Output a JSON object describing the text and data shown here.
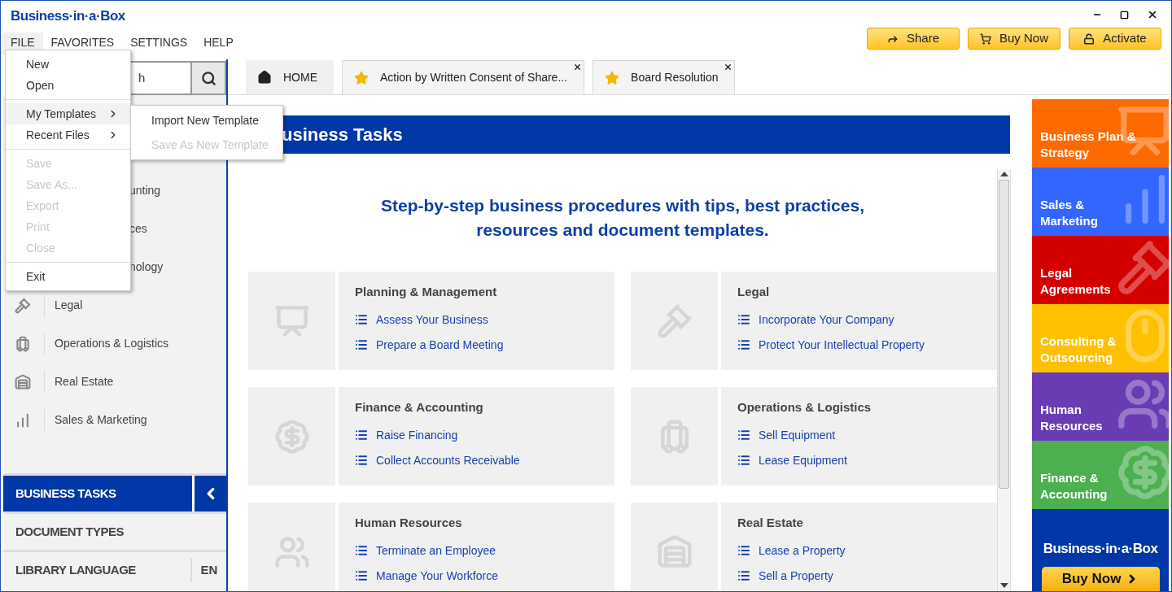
{
  "app": {
    "logo": "Business·in·a·Box"
  },
  "menu_bar": [
    {
      "label": "FILE",
      "selected": true
    },
    {
      "label": "FAVORITES",
      "selected": false
    },
    {
      "label": "SETTINGS",
      "selected": false
    },
    {
      "label": "HELP",
      "selected": false
    }
  ],
  "header_buttons": [
    {
      "label": "Share",
      "kind": "share"
    },
    {
      "label": "Buy Now",
      "kind": "cart"
    },
    {
      "label": "Activate",
      "kind": "lock"
    }
  ],
  "search": {
    "placeholder": "h"
  },
  "tabs": [
    {
      "label": "HOME",
      "kind": "home",
      "selected": true,
      "closable": false
    },
    {
      "label": "Action by Written Consent of Share...",
      "kind": "star",
      "selected": false,
      "closable": true
    },
    {
      "label": "Board Resolution",
      "kind": "star",
      "selected": false,
      "closable": true
    }
  ],
  "sidebar": {
    "items": [
      {
        "label": "unting",
        "kind": "covered"
      },
      {
        "label": "ces",
        "kind": "covered"
      },
      {
        "label": "nology",
        "kind": "covered"
      },
      {
        "label": "Legal",
        "kind": "legal"
      },
      {
        "label": "Operations & Logistics",
        "kind": "cart"
      },
      {
        "label": "Real Estate",
        "kind": "building"
      },
      {
        "label": "Sales & Marketing",
        "kind": "chart"
      }
    ],
    "sections": [
      {
        "label": "BUSINESS TASKS",
        "selected": true
      },
      {
        "label": "DOCUMENT TYPES",
        "selected": false
      },
      {
        "label": "LIBRARY LANGUAGE",
        "selected": false,
        "value": "EN"
      }
    ]
  },
  "file_menu": [
    {
      "label": "New",
      "kind": "item",
      "disabled": false,
      "highlighted": false
    },
    {
      "label": "Open",
      "kind": "item",
      "disabled": false,
      "highlighted": false
    },
    {
      "kind": "separator"
    },
    {
      "label": "My Templates",
      "kind": "submenu",
      "disabled": false,
      "highlighted": true
    },
    {
      "label": "Recent Files",
      "kind": "submenu",
      "disabled": false,
      "highlighted": false
    },
    {
      "kind": "separator"
    },
    {
      "label": "Save",
      "kind": "item",
      "disabled": true,
      "highlighted": false
    },
    {
      "label": "Save As...",
      "kind": "item",
      "disabled": true,
      "highlighted": false
    },
    {
      "label": "Export",
      "kind": "item",
      "disabled": true,
      "highlighted": false
    },
    {
      "label": "Print",
      "kind": "item",
      "disabled": true,
      "highlighted": false
    },
    {
      "label": "Close",
      "kind": "item",
      "disabled": true,
      "highlighted": false
    },
    {
      "kind": "separator"
    },
    {
      "label": "Exit",
      "kind": "item",
      "disabled": false,
      "highlighted": false
    }
  ],
  "templates_submenu": [
    {
      "label": "Import New Template",
      "disabled": false
    },
    {
      "label": "Save As New Template",
      "disabled": true
    }
  ],
  "content": {
    "heading": "usiness Tasks",
    "tagline": "Step-by-step business procedures with tips, best practices, resources and document templates.",
    "cards": [
      {
        "title": "Planning & Management",
        "kind": "presentation",
        "links": [
          "Assess Your Business",
          "Prepare a Board Meeting"
        ]
      },
      {
        "title": "Legal",
        "kind": "gavel",
        "links": [
          "Incorporate Your Company",
          "Protect Your Intellectual Property"
        ]
      },
      {
        "title": "Finance & Accounting",
        "kind": "money",
        "links": [
          "Raise Financing",
          "Collect Accounts Receivable"
        ]
      },
      {
        "title": "Operations & Logistics",
        "kind": "cart",
        "links": [
          "Sell Equipment",
          "Lease Equipment"
        ]
      },
      {
        "title": "Human Resources",
        "kind": "people",
        "links": [
          "Terminate an Employee",
          "Manage Your Workforce"
        ]
      },
      {
        "title": "Real Estate",
        "kind": "building",
        "links": [
          "Lease a Property",
          "Sell a Property"
        ]
      }
    ]
  },
  "categories": [
    {
      "label": "Business Plan & Strategy",
      "color": "#ff6a00",
      "kind": "presentation"
    },
    {
      "label": "Sales & Marketing",
      "color": "#3366ff",
      "kind": "chart"
    },
    {
      "label": "Legal Agreements",
      "color": "#d40000",
      "kind": "gavel"
    },
    {
      "label": "Consulting & Outsourcing",
      "color": "#ffc000",
      "kind": "mouse"
    },
    {
      "label": "Human Resources",
      "color": "#6a3cb4",
      "kind": "people"
    },
    {
      "label": "Finance & Accounting",
      "color": "#4caf50",
      "kind": "money"
    }
  ],
  "promo": {
    "logo": "Business·in·a·Box",
    "button": "Buy Now"
  }
}
